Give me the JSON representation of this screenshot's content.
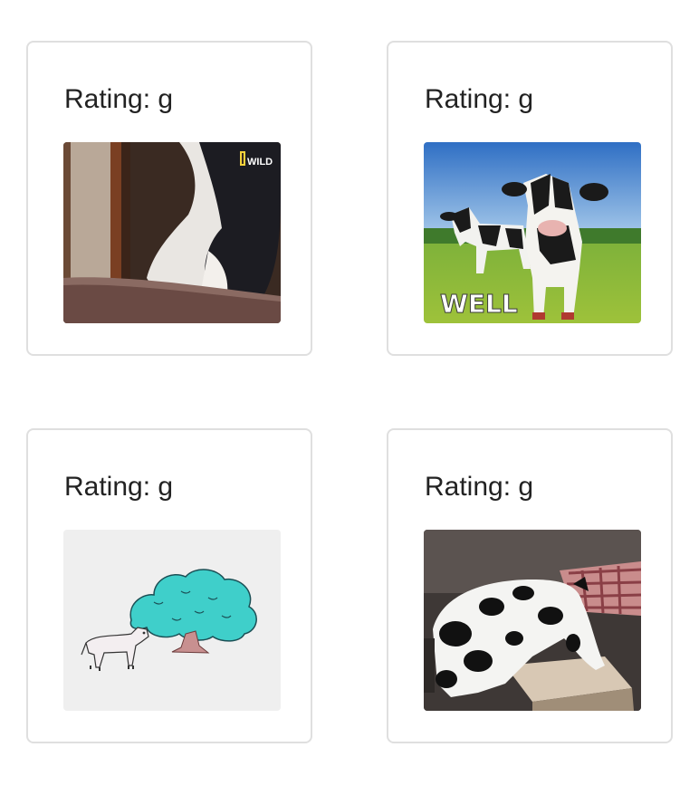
{
  "cards": [
    {
      "rating_label": "Rating: g",
      "image": {
        "description_name": "cow-peeking-gif",
        "watermark": "WILD"
      }
    },
    {
      "rating_label": "Rating: g",
      "image": {
        "description_name": "painted-cows-gif",
        "caption": "WELL"
      }
    },
    {
      "rating_label": "Rating: g",
      "image": {
        "description_name": "cartoon-cow-tree-gif"
      }
    },
    {
      "rating_label": "Rating: g",
      "image": {
        "description_name": "cow-costume-dog-gif"
      }
    }
  ]
}
